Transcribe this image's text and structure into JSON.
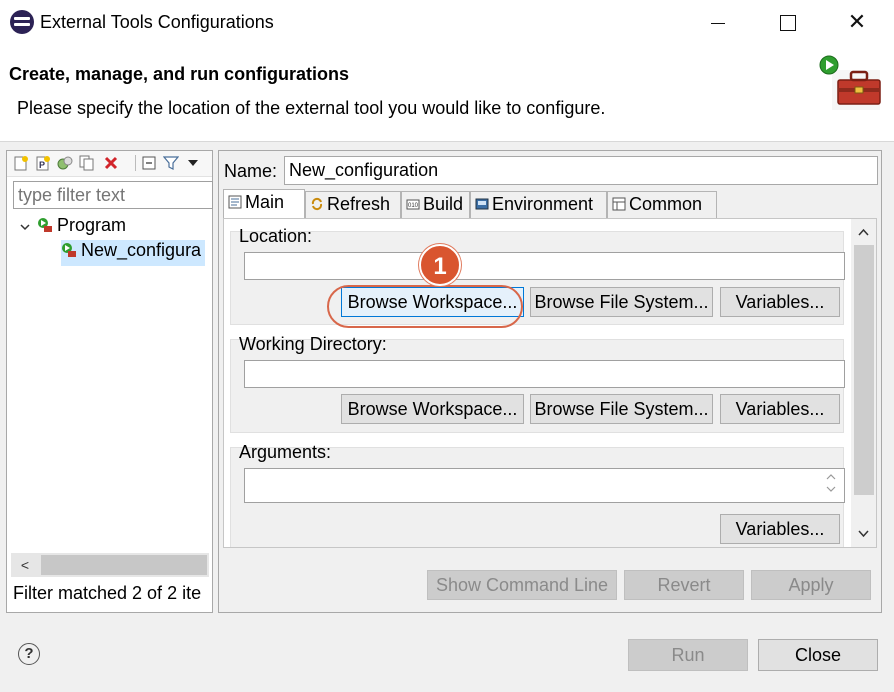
{
  "window": {
    "title": "External Tools Configurations",
    "minimize_symbol": "",
    "close_symbol": "✕"
  },
  "header": {
    "title": "Create, manage, and run configurations",
    "message": "Please specify the location of the external tool you would like to configure."
  },
  "left_panel": {
    "toolbar_icons": [
      "new-configuration-icon",
      "new-prototype-icon",
      "export-icon",
      "duplicate-icon",
      "delete-icon",
      "collapse-all-icon",
      "filter-icon",
      "view-menu-icon"
    ],
    "filter_placeholder": "type filter text",
    "tree": [
      {
        "label": "Program",
        "expanded": true
      },
      {
        "label": "New_configura",
        "selected": true
      }
    ],
    "scroll_left": "<",
    "status": "Filter matched 2 of 2 ite"
  },
  "editor": {
    "name_label": "Name:",
    "name_value": "New_configuration",
    "tabs": [
      {
        "label": "Main",
        "icon": "page-icon",
        "active": true
      },
      {
        "label": "Refresh",
        "icon": "refresh-icon"
      },
      {
        "label": "Build",
        "icon": "build-icon"
      },
      {
        "label": "Environment",
        "icon": "environment-icon"
      },
      {
        "label": "Common",
        "icon": "common-icon"
      }
    ],
    "location": {
      "label": "Location:",
      "value": "",
      "browse_workspace": "Browse Workspace...",
      "browse_filesystem": "Browse File System...",
      "variables": "Variables..."
    },
    "working_directory": {
      "label": "Working Directory:",
      "value": "",
      "browse_workspace": "Browse Workspace...",
      "browse_filesystem": "Browse File System...",
      "variables": "Variables..."
    },
    "arguments": {
      "label": "Arguments:",
      "value": "",
      "variables": "Variables..."
    },
    "show_command_line": "Show Command Line",
    "revert": "Revert",
    "apply": "Apply"
  },
  "callout": {
    "number": "1"
  },
  "footer": {
    "help_symbol": "?",
    "run": "Run",
    "close": "Close"
  },
  "colors": {
    "accent": "#0078d7",
    "callout": "#d9552f",
    "selection": "#cde8ff"
  }
}
